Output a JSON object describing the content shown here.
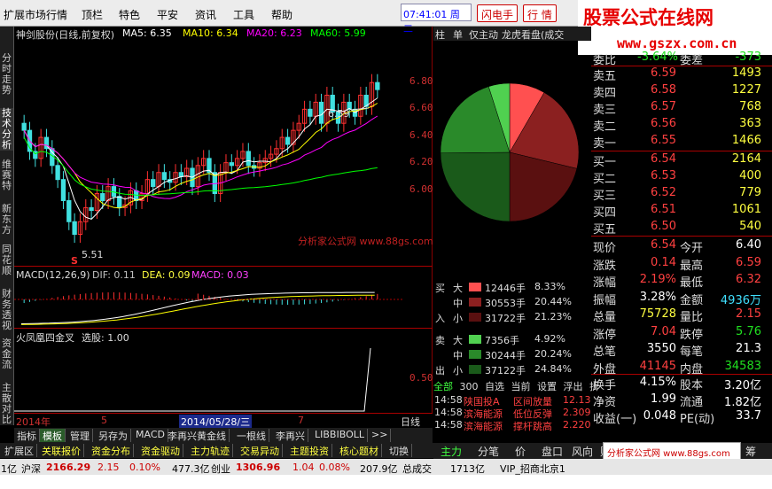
{
  "menu": [
    "扩展市场行情",
    "顶栏",
    "特色",
    "平安",
    "资讯",
    "工具",
    "帮助"
  ],
  "clock": "07:41:01 周二",
  "buttons": {
    "flash": "闪电手",
    "quote": "行 情"
  },
  "watermark": {
    "line1": "股票公式在线网",
    "line2": "www.gszx.com.cn"
  },
  "left_tabs": [
    "分时走势",
    "技术分析",
    "维赛特",
    "新东方",
    "同花顺",
    "财务透视",
    "资金流",
    "主散对比"
  ],
  "chart": {
    "title": "神剑股份(日线,前复权)",
    "ma": [
      {
        "label": "MA5: 6.35",
        "color": "#ffffff"
      },
      {
        "label": "MA10: 6.34",
        "color": "#ffff00"
      },
      {
        "label": "MA20: 6.23",
        "color": "#ff00ff"
      },
      {
        "label": "MA60: 5.99",
        "color": "#00ff00"
      }
    ],
    "price_axis": [
      "6.80",
      "6.60",
      "6.40",
      "6.20",
      "6.00"
    ],
    "high_label": "6.59",
    "low_label": "5.51",
    "s_mark": "S",
    "watermark": "分析家公式网 www.88gs.com",
    "macd": {
      "title": "MACD(12,26,9)",
      "dif": "DIF: 0.11",
      "dea": "DEA: 0.09",
      "macd": "MACD: 0.03"
    },
    "indicator": {
      "title": "火凤凰四金叉",
      "select": "选股: 1.00",
      "axis": "0.50"
    },
    "dates": {
      "year": "2014年",
      "m5": "5",
      "selected": "2014/05/28/三",
      "m7": "7",
      "period": "日线"
    }
  },
  "chart_data": [
    {
      "type": "candlestick",
      "title": "神剑股份(日线,前复权)",
      "ylim": [
        5.4,
        6.9
      ],
      "series": [
        {
          "name": "MA5",
          "last": 6.35
        },
        {
          "name": "MA10",
          "last": 6.34
        },
        {
          "name": "MA20",
          "last": 6.23
        },
        {
          "name": "MA60",
          "last": 5.99
        }
      ],
      "annotations": [
        "6.59",
        "5.51"
      ]
    },
    {
      "type": "pie",
      "values": [
        8.33,
        20.44,
        21.23,
        4.92,
        20.24,
        24.84
      ],
      "categories": [
        "买大",
        "买中",
        "买小",
        "卖大",
        "卖中",
        "卖小"
      ]
    }
  ],
  "tabs1": [
    "指标",
    "模板",
    "管理",
    "另存为",
    "MACD",
    "李再兴黄金线",
    "一根线",
    "李再兴",
    "LIBBIBOLL",
    ">>"
  ],
  "tabs2": [
    "扩展区",
    "关联报价",
    "资金分布",
    "资金驱动",
    "主力轨迹",
    "交易异动",
    "主题投资",
    "核心题材",
    "切换"
  ],
  "mid": {
    "tabs": [
      "柱",
      "单",
      "仅主动",
      "龙虎看盘(成交"
    ],
    "buy": [
      {
        "size": "大",
        "vol": "12446手",
        "pct": "8.33%",
        "color": "#ff5050"
      },
      {
        "size": "中",
        "vol": "30553手",
        "pct": "20.44%",
        "color": "#8b2020"
      },
      {
        "size": "小",
        "vol": "31722手",
        "pct": "21.23%",
        "color": "#5a1010"
      }
    ],
    "sell": [
      {
        "size": "大",
        "vol": "7356手",
        "pct": "4.92%",
        "color": "#50d050"
      },
      {
        "size": "中",
        "vol": "30244手",
        "pct": "20.24%",
        "color": "#2a8a2a"
      },
      {
        "size": "小",
        "vol": "37122手",
        "pct": "24.84%",
        "color": "#1a5a1a"
      }
    ],
    "buy_label": [
      "买",
      "入"
    ],
    "sell_label": [
      "卖",
      "出"
    ],
    "filter": [
      "全部",
      "300",
      "自选",
      "当前",
      "设置",
      "浮出",
      "折"
    ],
    "trades": [
      {
        "time": "14:58",
        "name": "陕国投A",
        "desc": "区间放量",
        "val": "12.135"
      },
      {
        "time": "14:58",
        "name": "滨海能源",
        "desc": "低位反弹",
        "val": "2.309"
      },
      {
        "time": "14:58",
        "name": "滨海能源",
        "desc": "撑杆跳高",
        "val": "2.220"
      }
    ]
  },
  "quote": {
    "top": {
      "l1": "委比",
      "v1": "-3.64%",
      "l2": "委差",
      "v2": "-373"
    },
    "sells": [
      {
        "l": "卖五",
        "p": "6.59",
        "v": "1493"
      },
      {
        "l": "卖四",
        "p": "6.58",
        "v": "1227"
      },
      {
        "l": "卖三",
        "p": "6.57",
        "v": "768"
      },
      {
        "l": "卖二",
        "p": "6.56",
        "v": "363"
      },
      {
        "l": "卖一",
        "p": "6.55",
        "v": "1466"
      }
    ],
    "buys": [
      {
        "l": "买一",
        "p": "6.54",
        "v": "2164"
      },
      {
        "l": "买二",
        "p": "6.53",
        "v": "400"
      },
      {
        "l": "买三",
        "p": "6.52",
        "v": "779"
      },
      {
        "l": "买四",
        "p": "6.51",
        "v": "1061"
      },
      {
        "l": "买五",
        "p": "6.50",
        "v": "540"
      }
    ],
    "stats": [
      {
        "l1": "现价",
        "v1": "6.54",
        "c1": "red",
        "l2": "今开",
        "v2": "6.40",
        "c2": "wht"
      },
      {
        "l1": "涨跌",
        "v1": "0.14",
        "c1": "red",
        "l2": "最高",
        "v2": "6.59",
        "c2": "red"
      },
      {
        "l1": "涨幅",
        "v1": "2.19%",
        "c1": "red",
        "l2": "最低",
        "v2": "6.32",
        "c2": "red"
      },
      {
        "l1": "振幅",
        "v1": "3.28%",
        "c1": "wht",
        "l2": "金额",
        "v2": "4936万",
        "c2": "cyn"
      },
      {
        "l1": "总量",
        "v1": "75728",
        "c1": "yel",
        "l2": "量比",
        "v2": "2.15",
        "c2": "red"
      },
      {
        "l1": "涨停",
        "v1": "7.04",
        "c1": "red",
        "l2": "跌停",
        "v2": "5.76",
        "c2": "grn"
      },
      {
        "l1": "总笔",
        "v1": "3550",
        "c1": "wht",
        "l2": "每笔",
        "v2": "21.3",
        "c2": "wht"
      },
      {
        "l1": "外盘",
        "v1": "41145",
        "c1": "red",
        "l2": "内盘",
        "v2": "34583",
        "c2": "grn"
      }
    ],
    "stats2": [
      {
        "l1": "换手",
        "v1": "4.15%",
        "l2": "股本",
        "v2": "3.20亿"
      },
      {
        "l1": "净资",
        "v1": "1.99",
        "l2": "流通",
        "v2": "1.82亿"
      },
      {
        "l1": "收益(一)",
        "v1": "0.048",
        "l2": "PE(动)",
        "v2": "33.7"
      }
    ]
  },
  "rtabs": [
    "主力",
    "分笔",
    "价",
    "盘口",
    "风向",
    "财",
    "筹"
  ],
  "ad": "分析家公式网 www.88gs.com",
  "status": {
    "a": "1亿",
    "b": "沪深",
    "c": "2166.29",
    "d": "2.15",
    "e": "0.10%",
    "f": "477.3亿",
    "g": "创业",
    "h": "1306.96",
    "i": "1.04",
    "j": "0.08%",
    "k": "207.9亿",
    "l": "总成交",
    "m": "1713亿",
    "n": "VIP_招商北京1"
  }
}
